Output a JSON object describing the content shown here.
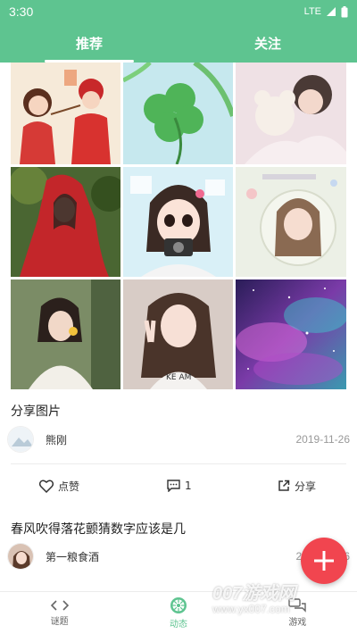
{
  "status_bar": {
    "time": "3:30",
    "network": "LTE"
  },
  "top_tabs": [
    {
      "label": "推荐",
      "active": true
    },
    {
      "label": "关注",
      "active": false
    }
  ],
  "gallery": [
    {
      "subject": "illustrated girl and boy in red costumes",
      "bg": "#f4e6d6"
    },
    {
      "subject": "green four-leaf clover on blue sky",
      "bg": "#bfe4ec"
    },
    {
      "subject": "girl hugging white teddy bear",
      "bg": "#ecdde1"
    },
    {
      "subject": "girl in red hooded cloak in forest",
      "bg": "#3f5a2a"
    },
    {
      "subject": "cartoon girl with camera",
      "bg": "#d6eef6"
    },
    {
      "subject": "illustrated girl in pastel frame",
      "bg": "#e6ece0"
    },
    {
      "subject": "girl with short hair holding flower",
      "bg": "#6b8060"
    },
    {
      "subject": "girl making peace sign",
      "bg": "#dfd3cc"
    },
    {
      "subject": "purple and teal galaxy sky",
      "bg": "#4b2c78"
    }
  ],
  "posts": [
    {
      "title": "分享图片",
      "author": "熊刚",
      "date": "2019-11-26"
    },
    {
      "title": "春风吹得落花颤猜数字应该是几",
      "author": "第一粮食酒",
      "date": "2019-11-26"
    }
  ],
  "actions": {
    "like": "点赞",
    "comment_count": "1",
    "share": "分享"
  },
  "bottom_nav": [
    {
      "label": "谜题",
      "icon": "code-brackets-icon",
      "active": false
    },
    {
      "label": "动态",
      "icon": "kiwi-slice-icon",
      "active": true
    },
    {
      "label": "游戏",
      "icon": "chat-bubbles-icon",
      "active": false
    }
  ],
  "watermark": {
    "line1": "007游戏网",
    "line2": "www.yx007.com"
  },
  "colors": {
    "brand_green": "#5ec490",
    "fab_red": "#f1454f",
    "date_gray": "#999999"
  }
}
